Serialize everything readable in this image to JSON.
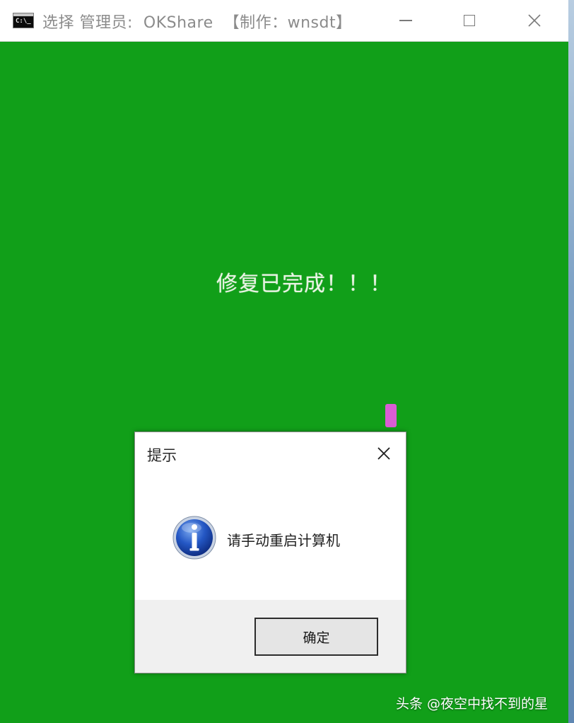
{
  "titlebar": {
    "title": "选择 管理员:  OKShare  【制作：wnsdt】",
    "icon": "cmd-icon",
    "minimize_icon": "minimize-icon",
    "maximize_icon": "maximize-icon",
    "close_icon": "close-icon"
  },
  "console": {
    "background_color": "#119f19",
    "message": "修复已完成！！！"
  },
  "dialog": {
    "title": "提示",
    "icon": "info-icon",
    "message": "请手动重启计算机",
    "ok_label": "确定"
  },
  "watermark": {
    "text": "头条 @夜空中找不到的星"
  }
}
